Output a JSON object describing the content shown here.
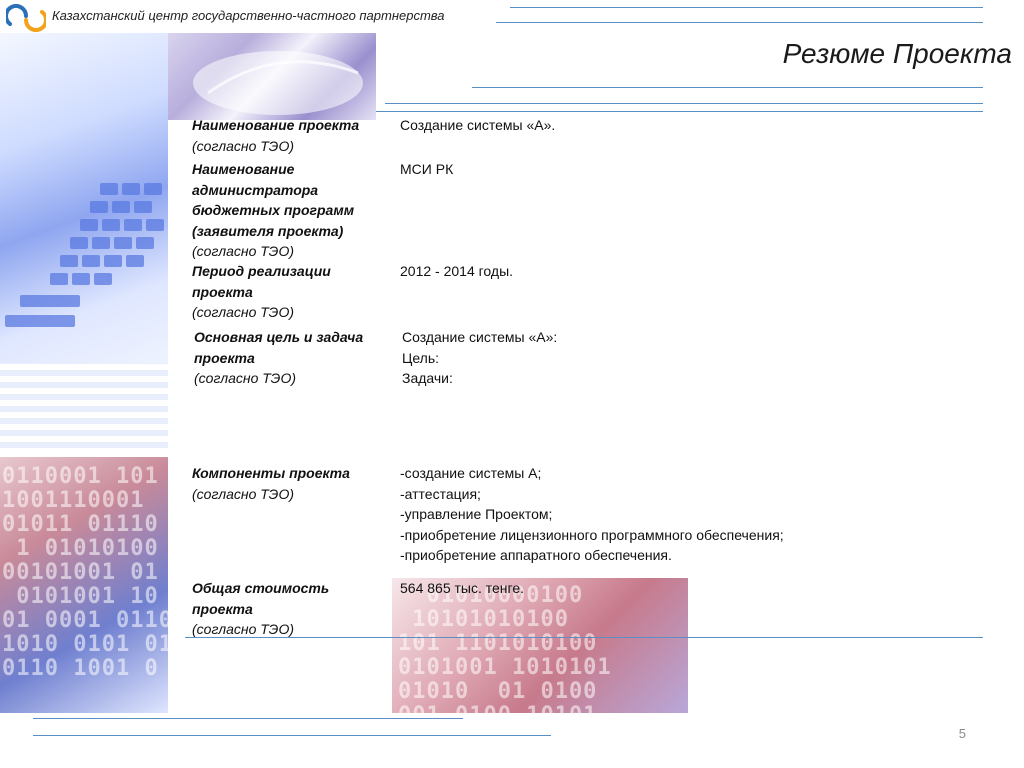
{
  "header": {
    "organization": "Казахстанский центр государственно-частного  партнерства",
    "title": "Резюме Проекта"
  },
  "rows": [
    {
      "label_bold": "Наименование проекта",
      "label_note": "(согласно  ТЭО)",
      "value": [
        "Создание системы «А»."
      ]
    },
    {
      "label_bold": "Наименование администратора бюджетных программ (заявителя проекта)",
      "label_note": "(согласно ТЭО)",
      "value": [
        "МСИ РК"
      ]
    },
    {
      "label_bold": "Период реализации проекта",
      "label_note": "(согласно ТЭО)",
      "value": [
        "2012 - 2014 годы."
      ]
    },
    {
      "label_bold": "Основная цель и задача проекта",
      "label_note": " (согласно ТЭО)",
      "value": [
        "Создание системы «А»:",
        "Цель:",
        "Задачи:"
      ]
    },
    {
      "label_bold": "Компоненты проекта",
      "label_note": "(согласно ТЭО)",
      "value": [
        "-создание системы А;",
        "-аттестация;",
        "-управление Проектом;",
        "-приобретение лицензионного программного обеспечения;",
        "-приобретение аппаратного обеспечения."
      ]
    },
    {
      "label_bold": "Общая стоимость проекта",
      "label_note": "(согласно ТЭО)",
      "value": [
        "564 865 тыс. тенге."
      ]
    }
  ],
  "footer": {
    "page_number": "5"
  },
  "colors": {
    "accent_line": "#5b8ec7",
    "logo_blue": "#2a6fb8",
    "logo_orange": "#f2a31b"
  },
  "icons": {
    "logo": "kcgchp-logo-icon"
  }
}
